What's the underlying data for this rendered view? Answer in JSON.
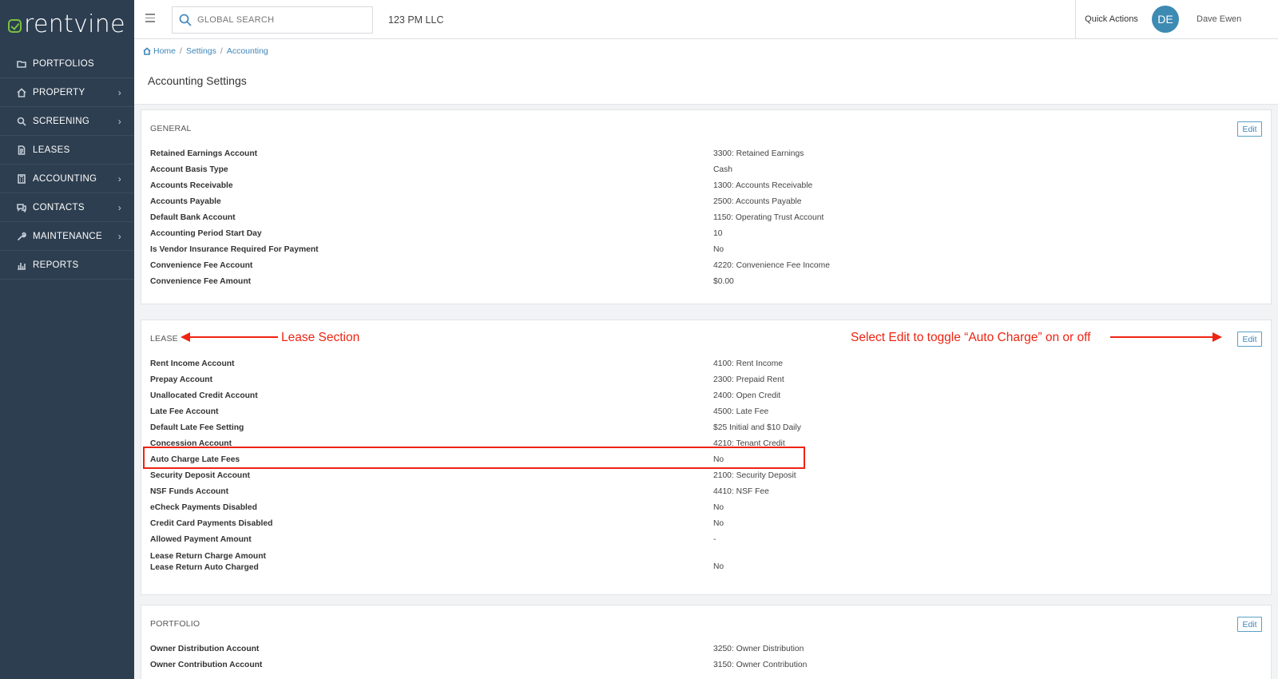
{
  "logo": {
    "text": "rentvine"
  },
  "sidebar": {
    "items": [
      {
        "label": "PORTFOLIOS",
        "icon": "folder-icon",
        "chevron": ""
      },
      {
        "label": "PROPERTY",
        "icon": "home-icon",
        "chevron": "›"
      },
      {
        "label": "SCREENING",
        "icon": "search-icon",
        "chevron": "›"
      },
      {
        "label": "LEASES",
        "icon": "document-icon",
        "chevron": ""
      },
      {
        "label": "ACCOUNTING",
        "icon": "calculator-icon",
        "chevron": "›"
      },
      {
        "label": "CONTACTS",
        "icon": "chat-icon",
        "chevron": "›"
      },
      {
        "label": "MAINTENANCE",
        "icon": "wrench-icon",
        "chevron": "›"
      },
      {
        "label": "REPORTS",
        "icon": "chart-icon",
        "chevron": ""
      }
    ]
  },
  "topbar": {
    "search_placeholder": "GLOBAL SEARCH",
    "company": "123 PM LLC",
    "quick_actions": "Quick Actions",
    "avatar_initials": "DE",
    "avatar_color": "#3d8ab3",
    "user_name": "Dave Ewen"
  },
  "breadcrumb": {
    "home": "Home",
    "settings": "Settings",
    "accounting": "Accounting",
    "separator": "/"
  },
  "page_title": "Accounting Settings",
  "panels": {
    "general": {
      "title": "GENERAL",
      "edit": "Edit",
      "rows": [
        {
          "label": "Retained Earnings Account",
          "value": "3300: Retained Earnings"
        },
        {
          "label": "Account Basis Type",
          "value": "Cash"
        },
        {
          "label": "Accounts Receivable",
          "value": "1300: Accounts Receivable"
        },
        {
          "label": "Accounts Payable",
          "value": "2500: Accounts Payable"
        },
        {
          "label": "Default Bank Account",
          "value": "1150: Operating Trust Account"
        },
        {
          "label": "Accounting Period Start Day",
          "value": "10"
        },
        {
          "label": "Is Vendor Insurance Required For Payment",
          "value": "No"
        },
        {
          "label": "Convenience Fee Account",
          "value": "4220: Convenience Fee Income"
        },
        {
          "label": "Convenience Fee Amount",
          "value": "$0.00"
        }
      ]
    },
    "lease": {
      "title": "LEASE",
      "edit": "Edit",
      "rows": [
        {
          "label": "Rent Income Account",
          "value": "4100: Rent Income"
        },
        {
          "label": "Prepay Account",
          "value": "2300: Prepaid Rent"
        },
        {
          "label": "Unallocated Credit Account",
          "value": "2400: Open Credit"
        },
        {
          "label": "Late Fee Account",
          "value": "4500: Late Fee"
        },
        {
          "label": "Default Late Fee Setting",
          "value": "$25 Initial and $10 Daily"
        },
        {
          "label": "Concession Account",
          "value": "4210: Tenant Credit"
        },
        {
          "label": "Auto Charge Late Fees",
          "value": "No"
        },
        {
          "label": "Security Deposit Account",
          "value": "2100: Security Deposit"
        },
        {
          "label": "NSF Funds Account",
          "value": "4410: NSF Fee"
        },
        {
          "label": "eCheck Payments Disabled",
          "value": "No"
        },
        {
          "label": "Credit Card Payments Disabled",
          "value": "No"
        },
        {
          "label": "Allowed Payment Amount",
          "value": "-"
        }
      ],
      "extra_label_1": "Lease Return Charge Amount",
      "extra_label_2": "Lease Return Auto Charged",
      "extra_value_2": "No"
    },
    "portfolio": {
      "title": "PORTFOLIO",
      "edit": "Edit",
      "rows": [
        {
          "label": "Owner Distribution Account",
          "value": "3250: Owner Distribution"
        },
        {
          "label": "Owner Contribution Account",
          "value": "3150: Owner Contribution"
        }
      ]
    }
  },
  "annotations": {
    "lease_section": "Lease Section",
    "edit_toggle": "Select Edit to toggle “Auto Charge” on or off",
    "color": "#ee2412"
  }
}
